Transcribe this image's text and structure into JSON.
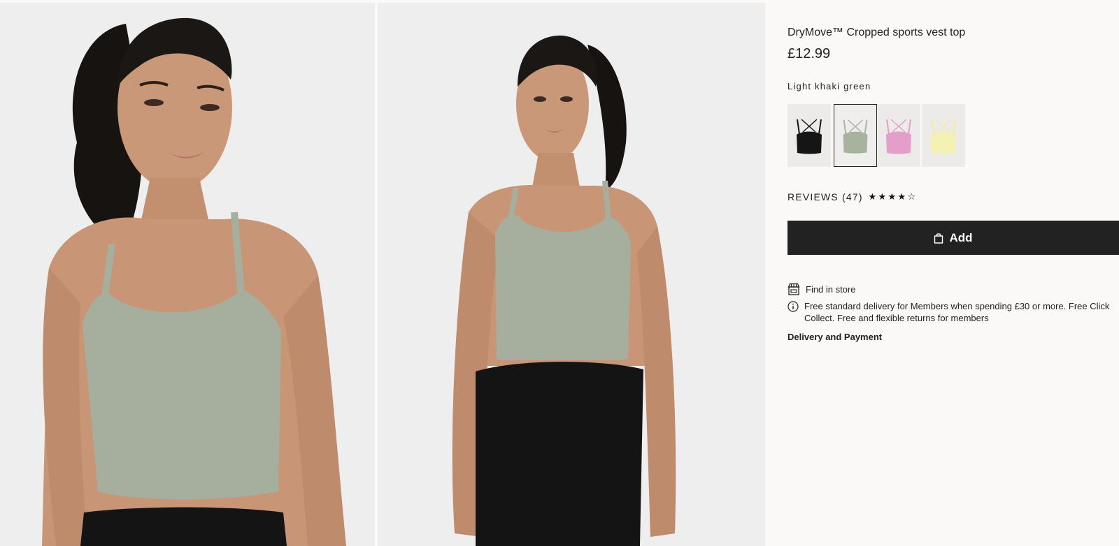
{
  "product": {
    "title": "DryMove™ Cropped sports vest top",
    "price": "£12.99",
    "selected_color": "Light khaki green"
  },
  "gallery": {
    "images": [
      {
        "name": "model-front-closeup"
      },
      {
        "name": "model-three-quarter"
      }
    ]
  },
  "swatches": [
    {
      "name": "Black",
      "color": "#151515"
    },
    {
      "name": "Light khaki green",
      "color": "#a8b29f",
      "selected": true
    },
    {
      "name": "Pink",
      "color": "#e39fc9"
    },
    {
      "name": "Light yellow",
      "color": "#f5f0b3"
    }
  ],
  "reviews": {
    "label": "REVIEWS (47)",
    "rating_filled": 4,
    "rating_max": 5
  },
  "actions": {
    "add_label": "Add",
    "find_in_store": "Find in store",
    "delivery_line1": "Free standard delivery for Members when spending £30 or more. Free Click",
    "delivery_line2": "Collect. Free and flexible returns for members",
    "delivery_payment": "Delivery and Payment"
  },
  "icons": {
    "bag": "shopping-bag-icon",
    "store": "store-icon",
    "info": "info-icon",
    "star_full": "★",
    "star_empty": "☆"
  },
  "colors": {
    "button_bg": "#222222",
    "page_bg": "#faf9f8",
    "photo_bg": "#efeeee"
  }
}
